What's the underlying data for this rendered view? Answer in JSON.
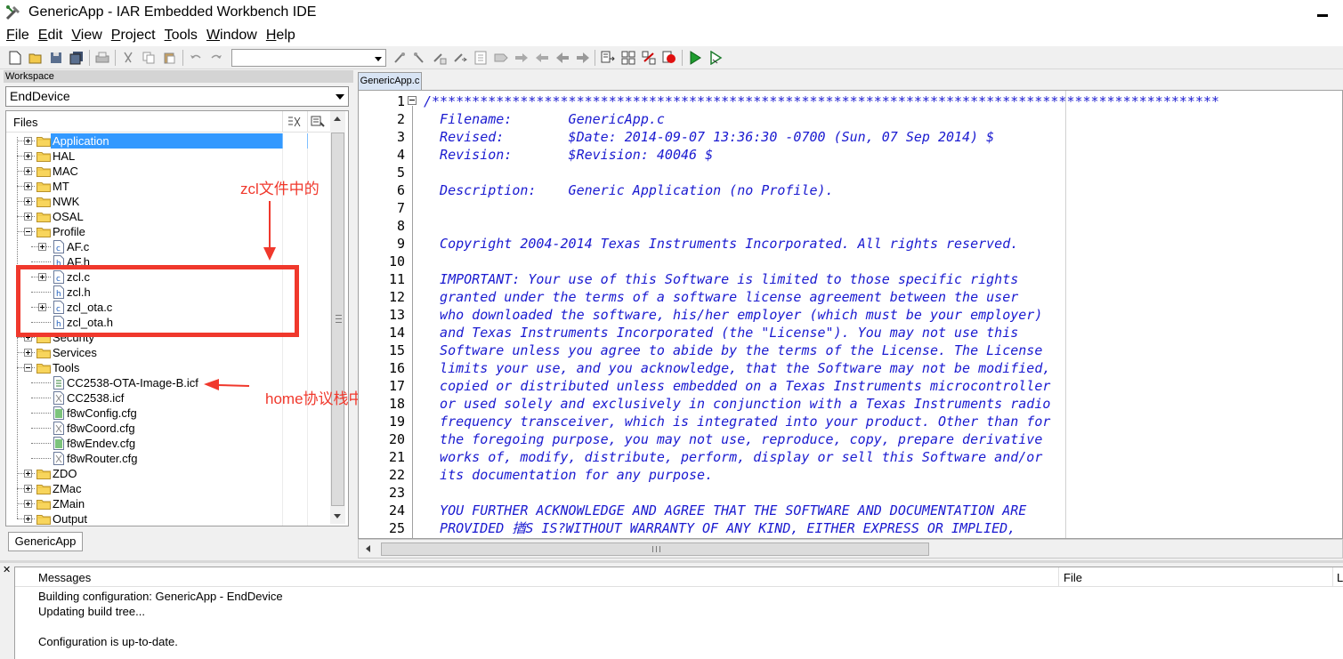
{
  "window": {
    "title": "GenericApp - IAR Embedded Workbench IDE"
  },
  "menu": [
    {
      "label": "File",
      "underline": "F",
      "rest": "ile"
    },
    {
      "label": "Edit",
      "underline": "E",
      "rest": "dit"
    },
    {
      "label": "View",
      "underline": "V",
      "rest": "iew"
    },
    {
      "label": "Project",
      "underline": "P",
      "rest": "roject"
    },
    {
      "label": "Tools",
      "underline": "T",
      "rest": "ools"
    },
    {
      "label": "Window",
      "underline": "W",
      "rest": "indow"
    },
    {
      "label": "Help",
      "underline": "H",
      "rest": "elp"
    }
  ],
  "toolbar": {
    "search_value": ""
  },
  "workspace": {
    "header": "Workspace",
    "configuration": "EndDevice",
    "files_column": "Files",
    "tab": "GenericApp",
    "tree": [
      {
        "label": "Application",
        "type": "folder",
        "expanded": false,
        "selected": true
      },
      {
        "label": "HAL",
        "type": "folder",
        "expanded": false
      },
      {
        "label": "MAC",
        "type": "folder",
        "expanded": false
      },
      {
        "label": "MT",
        "type": "folder",
        "expanded": false
      },
      {
        "label": "NWK",
        "type": "folder",
        "expanded": false
      },
      {
        "label": "OSAL",
        "type": "folder",
        "expanded": false
      },
      {
        "label": "Profile",
        "type": "folder",
        "expanded": true
      },
      {
        "label": "AF.c",
        "type": "c-file",
        "expandable": true
      },
      {
        "label": "AF.h",
        "type": "h-file"
      },
      {
        "label": "zcl.c",
        "type": "c-file",
        "expandable": true
      },
      {
        "label": "zcl.h",
        "type": "h-file"
      },
      {
        "label": "zcl_ota.c",
        "type": "c-file",
        "expandable": true
      },
      {
        "label": "zcl_ota.h",
        "type": "h-file"
      },
      {
        "label": "Security",
        "type": "folder",
        "expanded": false
      },
      {
        "label": "Services",
        "type": "folder",
        "expanded": false
      },
      {
        "label": "Tools",
        "type": "folder",
        "expanded": true
      },
      {
        "label": "CC2538-OTA-Image-B.icf",
        "type": "icf-file"
      },
      {
        "label": "CC2538.icf",
        "type": "excluded-file"
      },
      {
        "label": "f8wConfig.cfg",
        "type": "cfg-file"
      },
      {
        "label": "f8wCoord.cfg",
        "type": "excluded-file"
      },
      {
        "label": "f8wEndev.cfg",
        "type": "cfg-file"
      },
      {
        "label": "f8wRouter.cfg",
        "type": "excluded-file"
      },
      {
        "label": "ZDO",
        "type": "folder",
        "expanded": false
      },
      {
        "label": "ZMac",
        "type": "folder",
        "expanded": false
      },
      {
        "label": "ZMain",
        "type": "folder",
        "expanded": false
      },
      {
        "label": "Output",
        "type": "folder",
        "expanded": false
      }
    ]
  },
  "annotations": {
    "zcl_note": "zcl文件中的",
    "home_note": "home协议栈中的"
  },
  "editor": {
    "tab": "GenericApp.c",
    "lines": [
      {
        "n": "1",
        "text": "/**************************************************************************************************"
      },
      {
        "n": "2",
        "text": "  Filename:       GenericApp.c"
      },
      {
        "n": "3",
        "text": "  Revised:        $Date: 2014-09-07 13:36:30 -0700 (Sun, 07 Sep 2014) $"
      },
      {
        "n": "4",
        "text": "  Revision:       $Revision: 40046 $"
      },
      {
        "n": "5",
        "text": ""
      },
      {
        "n": "6",
        "text": "  Description:    Generic Application (no Profile)."
      },
      {
        "n": "7",
        "text": ""
      },
      {
        "n": "8",
        "text": ""
      },
      {
        "n": "9",
        "text": "  Copyright 2004-2014 Texas Instruments Incorporated. All rights reserved."
      },
      {
        "n": "10",
        "text": ""
      },
      {
        "n": "11",
        "text": "  IMPORTANT: Your use of this Software is limited to those specific rights"
      },
      {
        "n": "12",
        "text": "  granted under the terms of a software license agreement between the user"
      },
      {
        "n": "13",
        "text": "  who downloaded the software, his/her employer (which must be your employer)"
      },
      {
        "n": "14",
        "text": "  and Texas Instruments Incorporated (the \"License\"). You may not use this"
      },
      {
        "n": "15",
        "text": "  Software unless you agree to abide by the terms of the License. The License"
      },
      {
        "n": "16",
        "text": "  limits your use, and you acknowledge, that the Software may not be modified,"
      },
      {
        "n": "17",
        "text": "  copied or distributed unless embedded on a Texas Instruments microcontroller"
      },
      {
        "n": "18",
        "text": "  or used solely and exclusively in conjunction with a Texas Instruments radio"
      },
      {
        "n": "19",
        "text": "  frequency transceiver, which is integrated into your product. Other than for"
      },
      {
        "n": "20",
        "text": "  the foregoing purpose, you may not use, reproduce, copy, prepare derivative"
      },
      {
        "n": "21",
        "text": "  works of, modify, distribute, perform, display or sell this Software and/or"
      },
      {
        "n": "22",
        "text": "  its documentation for any purpose."
      },
      {
        "n": "23",
        "text": ""
      },
      {
        "n": "24",
        "text": "  YOU FURTHER ACKNOWLEDGE AND AGREE THAT THE SOFTWARE AND DOCUMENTATION ARE"
      },
      {
        "n": "25",
        "text": "  PROVIDED 揂S IS?WITHOUT WARRANTY OF ANY KIND, EITHER EXPRESS OR IMPLIED,"
      }
    ]
  },
  "messages": {
    "col_messages": "Messages",
    "col_file": "File",
    "col_line": "L",
    "lines": [
      "Building configuration: GenericApp - EndDevice",
      "Updating build tree...",
      "",
      "Configuration is up-to-date."
    ]
  },
  "colors": {
    "annotation_red": "#f0382c",
    "selection_blue": "#3399ff",
    "code_blue": "#1a1ad0"
  }
}
